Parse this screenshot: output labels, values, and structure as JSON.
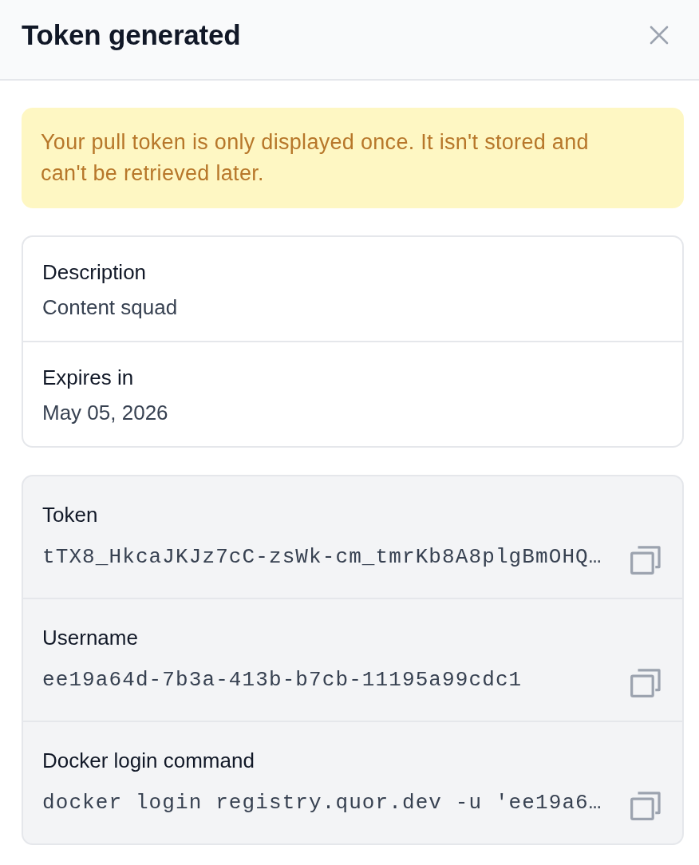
{
  "dialog": {
    "title": "Token generated"
  },
  "alert": {
    "text": "Your pull token is only displayed once. It isn't stored and can't be retrieved later."
  },
  "details": [
    {
      "label": "Description",
      "value": "Content squad"
    },
    {
      "label": "Expires in",
      "value": "May 05, 2026"
    }
  ],
  "secrets": [
    {
      "label": "Token",
      "value": "tTX8_HkcaJKJz7cC-zsWk-cm_tmrKb8A8plgBmOHQ…"
    },
    {
      "label": "Username",
      "value": "ee19a64d-7b3a-413b-b7cb-11195a99cdc1"
    },
    {
      "label": "Docker login command",
      "value": "docker login registry.quor.dev -u 'ee19a6…"
    }
  ]
}
